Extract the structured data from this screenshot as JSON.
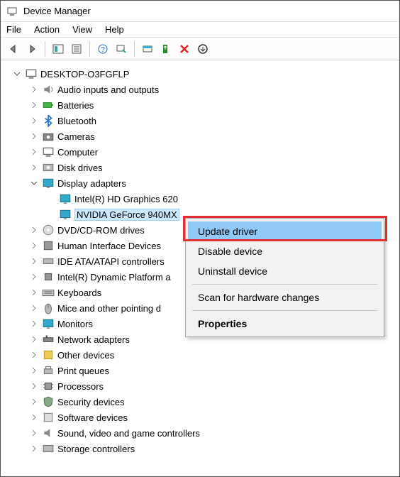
{
  "window": {
    "title": "Device Manager"
  },
  "menu": {
    "file": "File",
    "action": "Action",
    "view": "View",
    "help": "Help"
  },
  "tree": {
    "root": "DESKTOP-O3FGFLP",
    "items": [
      {
        "label": "Audio inputs and outputs"
      },
      {
        "label": "Batteries"
      },
      {
        "label": "Bluetooth"
      },
      {
        "label": "Cameras"
      },
      {
        "label": "Computer"
      },
      {
        "label": "Disk drives"
      },
      {
        "label": "Display adapters",
        "expanded": true,
        "children": [
          {
            "label": "Intel(R) HD Graphics 620"
          },
          {
            "label": "NVIDIA GeForce 940MX",
            "selected": true
          }
        ]
      },
      {
        "label": "DVD/CD-ROM drives"
      },
      {
        "label": "Human Interface Devices"
      },
      {
        "label": "IDE ATA/ATAPI controllers"
      },
      {
        "label": "Intel(R) Dynamic Platform a"
      },
      {
        "label": "Keyboards"
      },
      {
        "label": "Mice and other pointing d"
      },
      {
        "label": "Monitors"
      },
      {
        "label": "Network adapters"
      },
      {
        "label": "Other devices"
      },
      {
        "label": "Print queues"
      },
      {
        "label": "Processors"
      },
      {
        "label": "Security devices"
      },
      {
        "label": "Software devices"
      },
      {
        "label": "Sound, video and game controllers"
      },
      {
        "label": "Storage controllers"
      }
    ]
  },
  "context_menu": {
    "update": "Update driver",
    "disable": "Disable device",
    "uninstall": "Uninstall device",
    "scan": "Scan for hardware changes",
    "properties": "Properties"
  }
}
